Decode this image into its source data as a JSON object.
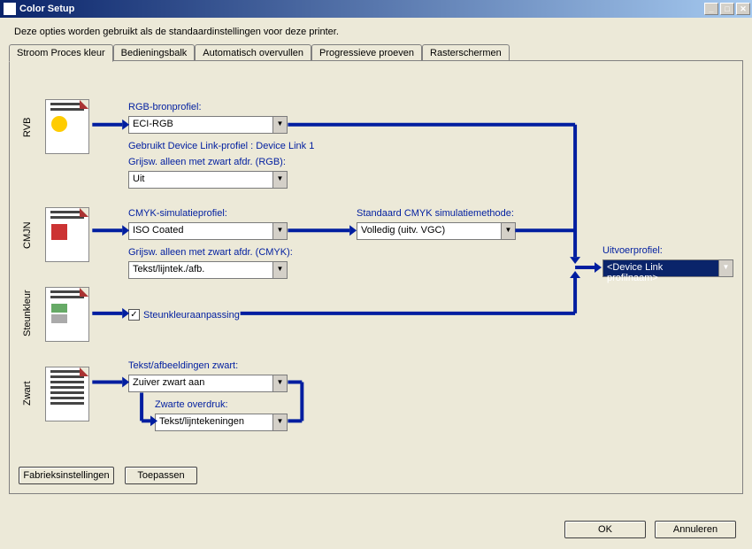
{
  "window": {
    "title": "Color Setup",
    "intro": "Deze opties worden gebruikt als de standaardinstellingen voor deze printer."
  },
  "tabs": [
    "Stroom Proces kleur",
    "Bedieningsbalk",
    "Automatisch overvullen",
    "Progressieve proeven",
    "Rasterschermen"
  ],
  "sideLabels": {
    "rvb": "RVB",
    "cmjn": "CMJN",
    "steun": "Steunkleur",
    "zwart": "Zwart"
  },
  "labels": {
    "rgbSource": "RGB-bronprofiel:",
    "deviceLinkUsed": "Gebruikt Device Link-profiel : Device Link 1",
    "grayRGB": "Grijsw. alleen met zwart afdr. (RGB):",
    "cmykSim": "CMYK-simulatieprofiel:",
    "cmykMethod": "Standaard CMYK simulatiemethode:",
    "grayCMYK": "Grijsw. alleen met zwart afdr. (CMYK):",
    "spot": "Steunkleuraanpassing",
    "textBlack": "Tekst/afbeeldingen zwart:",
    "blackOverprint": "Zwarte overdruk:",
    "outputProfile": "Uitvoerprofiel:"
  },
  "values": {
    "rgbSource": "ECI-RGB",
    "grayRGB": "Uit",
    "cmykSim": "ISO Coated",
    "cmykMethod": "Volledig (uitv. VGC)",
    "grayCMYK": "Tekst/lijntek./afb.",
    "spotChecked": "✓",
    "textBlack": "Zuiver zwart aan",
    "blackOverprint": "Tekst/lijntekeningen",
    "outputProfile": "<Device Link profilnaam>"
  },
  "buttons": {
    "factory": "Fabrieksinstellingen",
    "apply": "Toepassen",
    "ok": "OK",
    "cancel": "Annuleren"
  }
}
